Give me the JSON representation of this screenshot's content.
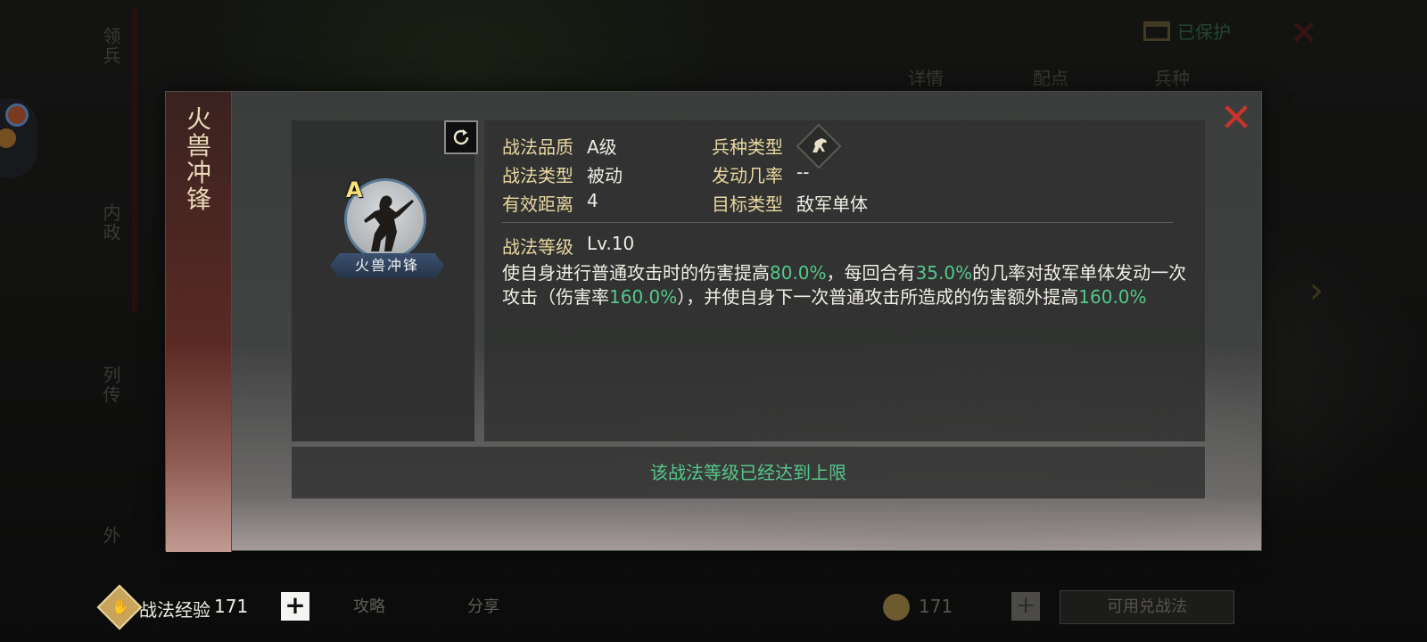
{
  "background": {
    "side_menu": [
      "领兵",
      "内政",
      "列传",
      "外"
    ],
    "tabs": [
      "详情",
      "配点",
      "兵种"
    ],
    "protect_label": "已保护",
    "bottom_buttons": [
      "攻略",
      "分享"
    ],
    "coin_value": "171",
    "exchange_label": "可用兑战法"
  },
  "modal": {
    "title": "火兽冲锋",
    "close_icon": "close-x-icon",
    "refresh_icon": "refresh-icon",
    "portrait": {
      "grade": "A",
      "name": "火兽冲锋"
    },
    "attributes": {
      "quality_label": "战法品质",
      "quality_value": "A级",
      "type_label": "战法类型",
      "type_value": "被动",
      "range_label": "有效距离",
      "range_value": "4",
      "unit_label": "兵种类型",
      "unit_icon": "cavalry-horse-icon",
      "chance_label": "发动几率",
      "chance_value": "--",
      "target_label": "目标类型",
      "target_value": "敌军单体"
    },
    "level_label": "战法等级",
    "level_value": "Lv.10",
    "description": {
      "p1": "使自身进行普通攻击时的伤害提高",
      "v1": "80.0%",
      "p2": "，每回合有",
      "v2": "35.0%",
      "p3": "的几率对敌军单体发动一次攻击（伤害率",
      "v3": "160.0%",
      "p4": "），并使自身下一次普通攻击所造成的伤害额外提高",
      "v4": "160.0%"
    },
    "max_level_message": "该战法等级已经达到上限"
  },
  "footer": {
    "exp_label": "战法经验",
    "exp_value": "171",
    "add_label": "+"
  },
  "colors": {
    "highlight_green": "#55c88a",
    "label_gold": "#e8d7a0",
    "close_red": "#c8352c"
  }
}
